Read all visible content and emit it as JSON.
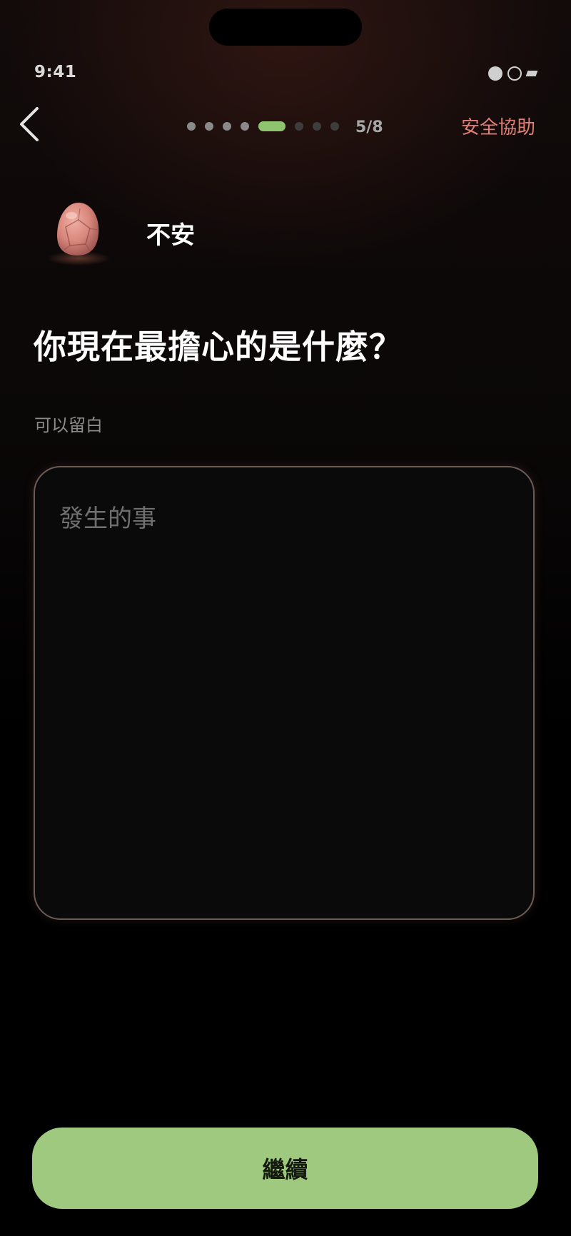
{
  "status_bar": {
    "time": "9:41"
  },
  "header": {
    "progress": {
      "current": 5,
      "total": 8,
      "label": "5/8"
    },
    "safety_help_label": "安全協助"
  },
  "emotion": {
    "label": "不安",
    "stone_color": "#d9877c"
  },
  "question": {
    "title": "你現在最擔心的是什麼？",
    "hint": "可以留白"
  },
  "input": {
    "value": "",
    "placeholder": "發生的事"
  },
  "footer": {
    "continue_label": "繼續"
  },
  "colors": {
    "accent": "#a0c980",
    "progress_active": "#8fc46f",
    "safety_link": "#e07f74"
  }
}
